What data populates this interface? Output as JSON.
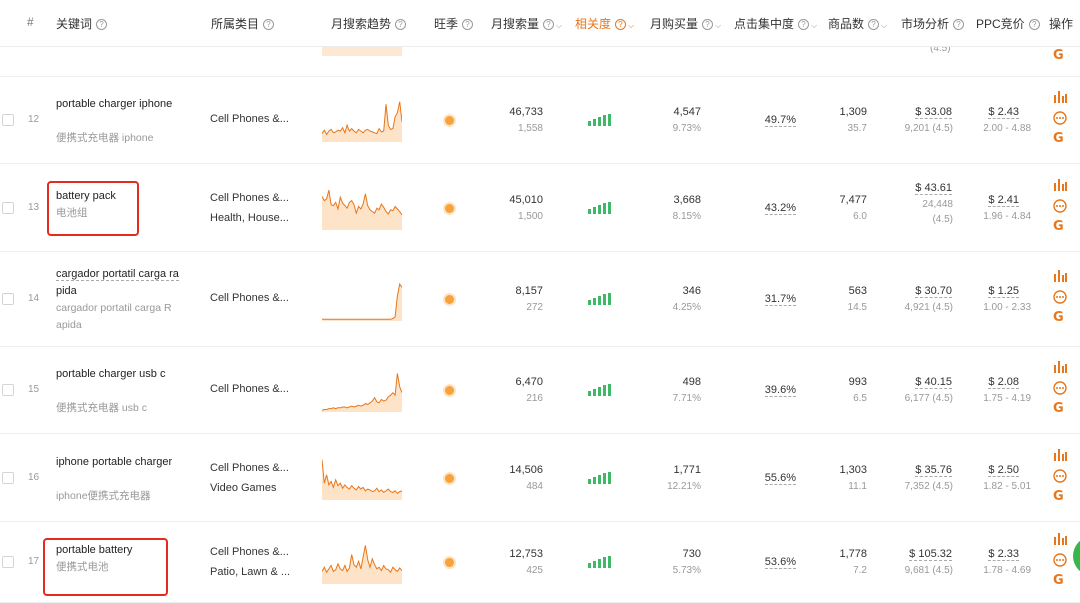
{
  "headers": {
    "num": "#",
    "keyword": "关键词",
    "category": "所属类目",
    "trend": "月搜索趋势",
    "season": "旺季",
    "search_volume": "月搜索量",
    "relevance": "相关度",
    "purchase": "月购买量",
    "click_conc": "点击集中度",
    "products": "商品数",
    "market": "市场分析",
    "ppc": "PPC竞价",
    "ops": "操作"
  },
  "accent_color": "#e8761a",
  "top_partial": {
    "market_sub": "(4.5)"
  },
  "rows": [
    {
      "num": "12",
      "keyword": "portable charger iphone",
      "keyword_cn": "便携式充电器 iphone",
      "categories": [
        "Cell Phones &..."
      ],
      "search_volume": "46,733",
      "search_sub": "1,558",
      "relevance_bars": 5,
      "purchase": "4,547",
      "purchase_pct": "9.73%",
      "click_conc": "49.7%",
      "products": "1,309",
      "products_sub": "35.7",
      "market_price": "$ 33.08",
      "market_reviews": "9,201 (4.5)",
      "ppc": "$ 2.43",
      "ppc_range": "2.00 - 4.88",
      "trend": [
        20,
        28,
        18,
        26,
        30,
        22,
        24,
        28,
        26,
        34,
        22,
        40,
        26,
        32,
        26,
        22,
        30,
        26,
        22,
        28,
        30,
        26,
        24,
        22,
        20,
        32,
        24,
        26,
        90,
        40,
        30,
        32,
        60,
        70,
        96,
        48
      ]
    },
    {
      "num": "13",
      "keyword": "battery pack",
      "keyword_cn": "电池组",
      "categories": [
        "Cell Phones &...",
        "Health, House..."
      ],
      "search_volume": "45,010",
      "search_sub": "1,500",
      "relevance_bars": 5,
      "purchase": "3,668",
      "purchase_pct": "8.15%",
      "click_conc": "43.2%",
      "products": "7,477",
      "products_sub": "6.0",
      "market_price": "$ 43.61",
      "market_reviews": "24,448",
      "market_rating": "(4.5)",
      "ppc": "$ 2.41",
      "ppc_range": "1.96 - 4.84",
      "trend": [
        80,
        70,
        74,
        95,
        60,
        58,
        66,
        50,
        78,
        64,
        58,
        52,
        66,
        70,
        60,
        40,
        56,
        50,
        62,
        86,
        58,
        48,
        44,
        40,
        52,
        48,
        62,
        54,
        44,
        38,
        48,
        46,
        56,
        50,
        44,
        36
      ]
    },
    {
      "num": "14",
      "keyword": "cargador portatil carga rapida",
      "keyword_lines": [
        "cargador portatil carga ra",
        "pida"
      ],
      "keyword_cn": "cargador portatil carga Rapida",
      "keyword_cn_lines": [
        "cargador portatil carga R",
        "apida"
      ],
      "categories": [
        "Cell Phones &..."
      ],
      "search_volume": "8,157",
      "search_sub": "272",
      "relevance_bars": 5,
      "purchase": "346",
      "purchase_pct": "4.25%",
      "click_conc": "31.7%",
      "products": "563",
      "products_sub": "14.5",
      "market_price": "$ 30.70",
      "market_reviews": "4,921 (4.5)",
      "ppc": "$ 1.25",
      "ppc_range": "1.00 - 2.33",
      "trend": [
        4,
        4,
        4,
        4,
        4,
        4,
        4,
        4,
        4,
        4,
        4,
        4,
        4,
        4,
        4,
        4,
        4,
        4,
        4,
        4,
        4,
        4,
        4,
        4,
        4,
        4,
        4,
        4,
        4,
        4,
        4,
        6,
        10,
        60,
        88,
        80
      ]
    },
    {
      "num": "15",
      "keyword": "portable charger usb c",
      "keyword_cn": "便携式充电器 usb c",
      "categories": [
        "Cell Phones &..."
      ],
      "search_volume": "6,470",
      "search_sub": "216",
      "relevance_bars": 5,
      "purchase": "498",
      "purchase_pct": "7.71%",
      "click_conc": "39.6%",
      "products": "993",
      "products_sub": "6.5",
      "market_price": "$ 40.15",
      "market_reviews": "6,177 (4.5)",
      "ppc": "$ 2.08",
      "ppc_range": "1.75 - 4.19",
      "trend": [
        4,
        6,
        6,
        8,
        8,
        10,
        8,
        10,
        10,
        12,
        12,
        10,
        12,
        14,
        12,
        14,
        16,
        14,
        16,
        20,
        18,
        22,
        26,
        34,
        24,
        22,
        30,
        26,
        28,
        36,
        40,
        46,
        40,
        92,
        60,
        46
      ]
    },
    {
      "num": "16",
      "keyword": "iphone portable charger",
      "keyword_cn": "iphone便携式充电器",
      "categories": [
        "Cell Phones &...",
        "Video Games"
      ],
      "search_volume": "14,506",
      "search_sub": "484",
      "relevance_bars": 5,
      "purchase": "1,771",
      "purchase_pct": "12.21%",
      "click_conc": "55.6%",
      "products": "1,303",
      "products_sub": "11.1",
      "market_price": "$ 35.76",
      "market_reviews": "7,352 (4.5)",
      "ppc": "$ 2.50",
      "ppc_range": "1.82 - 5.01",
      "trend": [
        96,
        40,
        60,
        36,
        44,
        30,
        48,
        34,
        40,
        28,
        36,
        30,
        26,
        34,
        28,
        24,
        32,
        26,
        30,
        22,
        26,
        24,
        20,
        22,
        28,
        20,
        24,
        18,
        22,
        26,
        20,
        18,
        22,
        16,
        20,
        22
      ]
    },
    {
      "num": "17",
      "keyword": "portable battery",
      "keyword_cn": "便携式电池",
      "categories": [
        "Cell Phones &...",
        "Patio, Lawn & ..."
      ],
      "search_volume": "12,753",
      "search_sub": "425",
      "relevance_bars": 5,
      "purchase": "730",
      "purchase_pct": "5.73%",
      "click_conc": "53.6%",
      "products": "1,778",
      "products_sub": "7.2",
      "market_price": "$ 105.32",
      "market_reviews": "9,681 (4.5)",
      "ppc": "$ 2.33",
      "ppc_range": "1.78 - 4.69",
      "trend": [
        30,
        40,
        28,
        36,
        44,
        30,
        34,
        48,
        36,
        32,
        44,
        30,
        38,
        70,
        46,
        40,
        54,
        36,
        64,
        92,
        58,
        40,
        60,
        46,
        36,
        40,
        32,
        44,
        36,
        34,
        28,
        40,
        34,
        30,
        38,
        32
      ]
    }
  ]
}
